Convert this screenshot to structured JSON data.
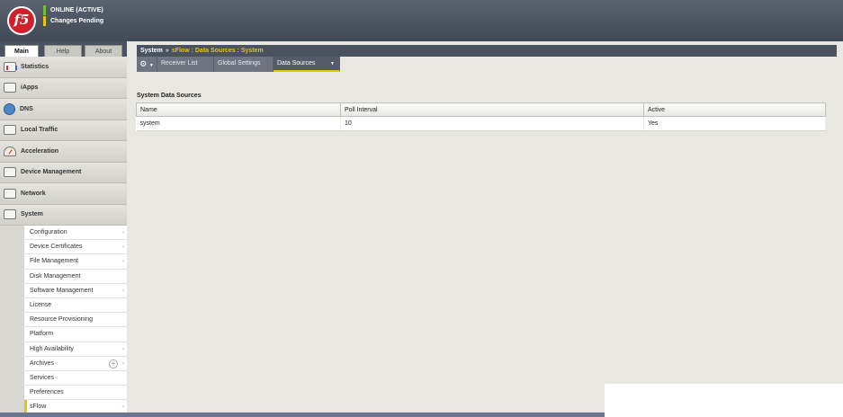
{
  "header": {
    "logo_text": "f5",
    "status_online": "ONLINE (ACTIVE)",
    "status_pending": "Changes Pending"
  },
  "nav_tabs": [
    "Main",
    "Help",
    "About"
  ],
  "sidebar": {
    "items": [
      {
        "label": "Statistics"
      },
      {
        "label": "iApps"
      },
      {
        "label": "DNS"
      },
      {
        "label": "Local Traffic"
      },
      {
        "label": "Acceleration"
      },
      {
        "label": "Device Management"
      },
      {
        "label": "Network"
      },
      {
        "label": "System"
      }
    ],
    "submenu": [
      {
        "label": "Configuration",
        "arrow": "›"
      },
      {
        "label": "Device Certificates",
        "arrow": "›"
      },
      {
        "label": "File Management",
        "arrow": "›"
      },
      {
        "label": "Disk Management",
        "arrow": ""
      },
      {
        "label": "Software Management",
        "arrow": "›"
      },
      {
        "label": "License",
        "arrow": ""
      },
      {
        "label": "Resource Provisioning",
        "arrow": ""
      },
      {
        "label": "Platform",
        "arrow": ""
      },
      {
        "label": "High Availability",
        "arrow": "›"
      },
      {
        "label": "Archives",
        "arrow": "›",
        "plus": "+"
      },
      {
        "label": "Services",
        "arrow": ""
      },
      {
        "label": "Preferences",
        "arrow": ""
      },
      {
        "label": "sFlow",
        "arrow": "›"
      }
    ]
  },
  "breadcrumb": {
    "root": "System",
    "separator": "»",
    "path": "sFlow : Data Sources : System"
  },
  "tabs": {
    "gear": "⚙",
    "caret": "▼",
    "items": [
      "Receiver List",
      "Global Settings",
      "Data Sources"
    ]
  },
  "table": {
    "title": "System Data Sources",
    "columns": [
      "Name",
      "Poll Interval",
      "Active"
    ],
    "rows": [
      [
        "system",
        "10",
        "Yes"
      ]
    ]
  },
  "colors": {
    "accent": "#e8c500",
    "header": "#4a5260",
    "online": "#6fbf3c"
  }
}
